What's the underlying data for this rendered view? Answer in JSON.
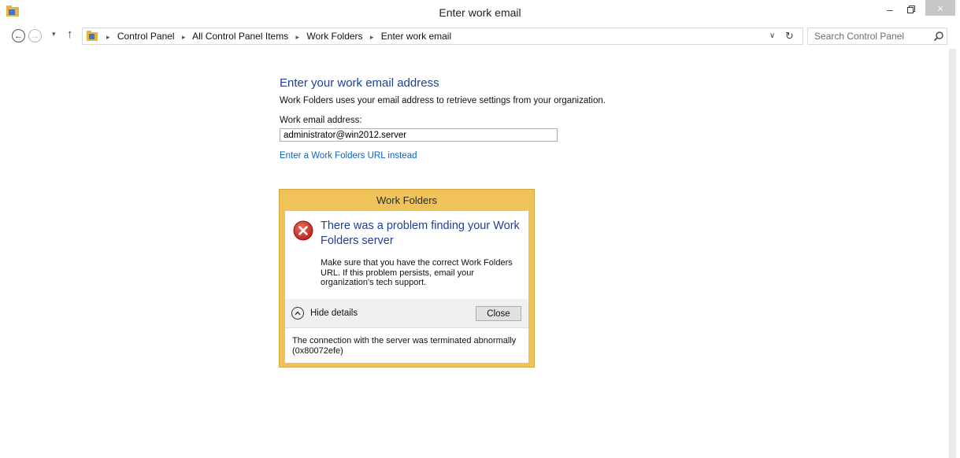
{
  "window": {
    "title": "Enter work email",
    "controls": {
      "minimize": "–",
      "maximize": "🗗",
      "close": "×"
    }
  },
  "navigation": {
    "back": "←",
    "forward": "→",
    "recent": "▾",
    "up": "↑",
    "breadcrumbs": [
      "Control Panel",
      "All Control Panel Items",
      "Work Folders",
      "Enter work email"
    ],
    "separator": "▸",
    "dropdown": "∨",
    "refresh": "↻",
    "search_placeholder": "Search Control Panel"
  },
  "main": {
    "heading": "Enter your work email address",
    "description": "Work Folders uses your email address to retrieve settings from your organization.",
    "email_label": "Work email address:",
    "email_value": "administrator@win2012.server",
    "url_link": "Enter a Work Folders URL instead"
  },
  "dialog": {
    "title": "Work Folders",
    "error_title": "There was a problem finding your Work Folders server",
    "error_message": "Make sure that you have the correct Work Folders URL. If this problem persists, email your organization's tech support.",
    "hide_details_label": "Hide details",
    "close_label": "Close",
    "details_text": "The connection with the server was terminated abnormally (0x80072efe)"
  },
  "colors": {
    "heading_blue": "#1e3f9a",
    "link_blue": "#0a62c6",
    "dialog_frame": "#efc25a",
    "error_red": "#c9302c"
  }
}
